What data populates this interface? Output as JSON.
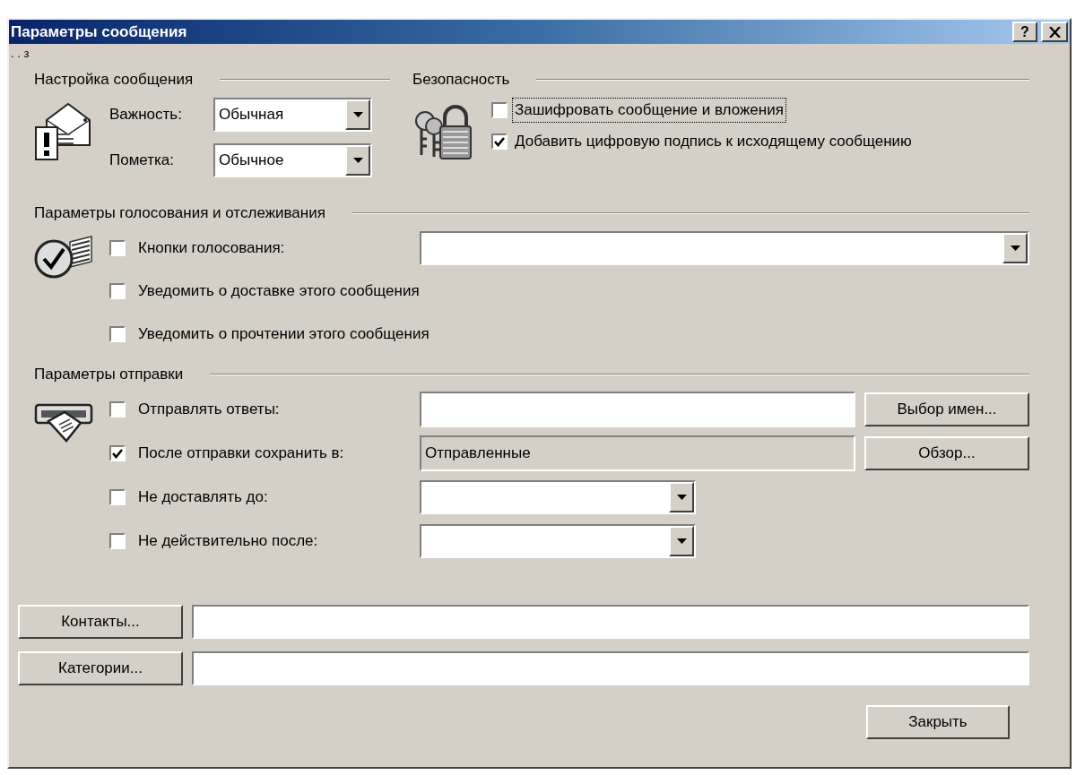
{
  "window": {
    "title": "Параметры сообщения",
    "help_button": "?"
  },
  "stray_text": ". . з",
  "message_settings": {
    "heading": "Настройка сообщения",
    "fields": [
      {
        "label": "Важность:",
        "value": "Обычная"
      },
      {
        "label": "Пометка:",
        "value": "Обычное"
      }
    ]
  },
  "security": {
    "heading": "Безопасность",
    "options": [
      {
        "label": "Зашифровать сообщение и вложения",
        "checked": false,
        "focused": true
      },
      {
        "label": "Добавить цифровую подпись к исходящему сообщению",
        "checked": true,
        "focused": false
      }
    ]
  },
  "voting": {
    "heading": "Параметры голосования и отслеживания",
    "options": [
      {
        "kind": "combo",
        "label": "Кнопки голосования:",
        "checked": false
      },
      {
        "kind": "plain",
        "label": "Уведомить о доставке этого сообщения",
        "checked": false
      },
      {
        "kind": "plain",
        "label": "Уведомить о прочтении этого сообщения",
        "checked": false
      }
    ]
  },
  "delivery": {
    "heading": "Параметры отправки",
    "options": [
      {
        "kind": "text",
        "label": "Отправлять ответы:",
        "checked": false,
        "button": "Выбор имен..."
      },
      {
        "kind": "readonly",
        "label": "После отправки сохранить в:",
        "checked": true,
        "value": "Отправленные",
        "button": "Обзор..."
      },
      {
        "kind": "date",
        "label": "Не доставлять до:",
        "checked": false
      },
      {
        "kind": "date",
        "label": "Не действительно после:",
        "checked": false
      }
    ]
  },
  "links": [
    {
      "button": "Контакты..."
    },
    {
      "button": "Категории..."
    }
  ],
  "close_button": "Закрыть"
}
